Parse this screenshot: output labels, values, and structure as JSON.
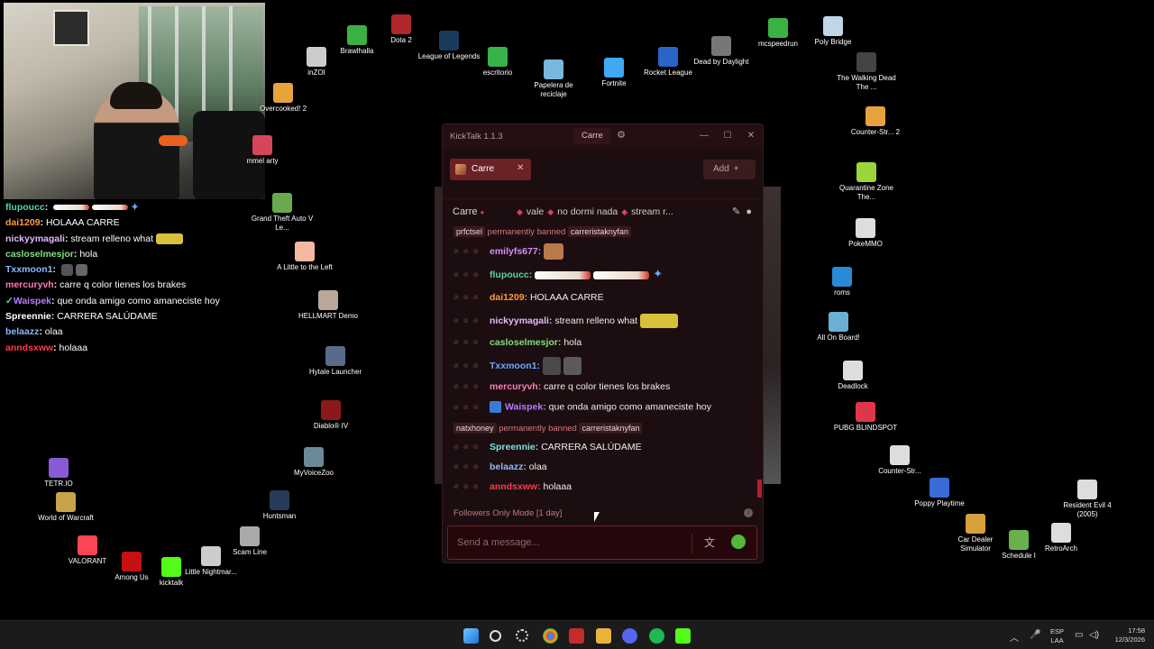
{
  "desktop_icons": [
    {
      "label": "Brawlhalla",
      "color": "#3bb143"
    },
    {
      "label": "Dota 2",
      "color": "#b0262c"
    },
    {
      "label": "League of Legends",
      "color": "#1a3a5c"
    },
    {
      "label": "escritorio",
      "color": "#37b34a"
    },
    {
      "label": "Papelera de reciclaje",
      "color": "#7ab7de"
    },
    {
      "label": "Fortnite",
      "color": "#3fa9f5"
    },
    {
      "label": "Rocket League",
      "color": "#2a64c9"
    },
    {
      "label": "Dead by Daylight",
      "color": "#777777"
    },
    {
      "label": "mcspeedrun",
      "color": "#3bb143"
    },
    {
      "label": "Poly Bridge",
      "color": "#c0d6e4"
    },
    {
      "label": "The Walking Dead The ...",
      "color": "#444444"
    },
    {
      "label": "inZOI",
      "color": "#cccccc"
    },
    {
      "label": "Overcooked! 2",
      "color": "#e8a33c"
    },
    {
      "label": "mmel arty",
      "color": "#d6455b"
    },
    {
      "label": "Grand Theft Auto V Le...",
      "color": "#6aa84f"
    },
    {
      "label": "A Little to the Left",
      "color": "#f2b8a0"
    },
    {
      "label": "HELLMART Demo",
      "color": "#b8a89a"
    },
    {
      "label": "Hytale Launcher",
      "color": "#5a6a8a"
    },
    {
      "label": "Diablo® IV",
      "color": "#8a1a1a"
    },
    {
      "label": "MyVoiceZoo",
      "color": "#6a8a9a"
    },
    {
      "label": "Huntsman",
      "color": "#2a3a5a"
    },
    {
      "label": "Scam Line",
      "color": "#aaaaaa"
    },
    {
      "label": "Little Nightmar...",
      "color": "#cccccc"
    },
    {
      "label": "kicktalk",
      "color": "#53fc18"
    },
    {
      "label": "Among Us",
      "color": "#c51111"
    },
    {
      "label": "VALORANT",
      "color": "#fd4556"
    },
    {
      "label": "World of Warcraft",
      "color": "#c7a34a"
    },
    {
      "label": "TETR.IO",
      "color": "#8a5ad6"
    },
    {
      "label": "Counter-Str... 2",
      "color": "#e6a23c"
    },
    {
      "label": "Quarantine Zone The...",
      "color": "#9ad63a"
    },
    {
      "label": "PokeMMO",
      "color": "#dddddd"
    },
    {
      "label": "roms",
      "color": "#2a8ad6"
    },
    {
      "label": "All On Board!",
      "color": "#6ab0d6"
    },
    {
      "label": "Deadlock",
      "color": "#dddddd"
    },
    {
      "label": "PUBG BLINDSPOT",
      "color": "#e0364b"
    },
    {
      "label": "Counter-Str...",
      "color": "#dddddd"
    },
    {
      "label": "Poppy Playtime",
      "color": "#3a6ad6"
    },
    {
      "label": "Car Dealer Simulator",
      "color": "#d6a03a"
    },
    {
      "label": "Schedule I",
      "color": "#6ab04c"
    },
    {
      "label": "RetroArch",
      "color": "#dddddd"
    },
    {
      "label": "Resident Evil 4 (2005)",
      "color": "#dddddd"
    }
  ],
  "overlay_chat": [
    {
      "user": "flupoucc",
      "color": "#53d6a0",
      "text": ""
    },
    {
      "user": "dai1209",
      "color": "#ff9a3c",
      "text": "HOLAAA CARRE"
    },
    {
      "user": "nickyymagali",
      "color": "#e4b8ff",
      "text": "stream relleno what"
    },
    {
      "user": "casloselmesjor",
      "color": "#7ee07e",
      "text": "hola"
    },
    {
      "user": "Txxmoon1",
      "color": "#8ab8ff",
      "text": ""
    },
    {
      "user": "mercuryvh",
      "color": "#ff7ab8",
      "text": "carre q color tienes los brakes"
    },
    {
      "user": "Waispek",
      "color": "#b57bff",
      "text": "que onda amigo como amaneciste hoy"
    },
    {
      "user": "Spreennie",
      "color": "#ffffff",
      "text": "CARRERA SALÚDAME"
    },
    {
      "user": "belaazz",
      "color": "#8ab8ff",
      "text": "olaa"
    },
    {
      "user": "anndsxww",
      "color": "#ff3a4a",
      "text": "holaaa"
    }
  ],
  "kicktalk": {
    "app_title": "KickTalk 1.1.3",
    "title_tab": "Carre",
    "channel_tab": "Carre",
    "add_label": "Add",
    "channel_name": "Carre",
    "stream_title": [
      "vale",
      "no dormi nada",
      "stream r..."
    ],
    "ban_1": {
      "user": "prfctsel",
      "text": "permanently banned",
      "by": "carreristaknyfan"
    },
    "messages": [
      {
        "user": "emilyfs677:",
        "color": "#d58cff",
        "text": ""
      },
      {
        "user": "flupoucc:",
        "color": "#53d6a0",
        "text": ""
      },
      {
        "user": "dai1209:",
        "color": "#ff9a3c",
        "text": "HOLAAA CARRE"
      },
      {
        "user": "nickyymagali:",
        "color": "#e4b8ff",
        "text": "stream relleno what"
      },
      {
        "user": "casloselmesjor:",
        "color": "#7ee07e",
        "text": "hola"
      },
      {
        "user": "Txxmoon1:",
        "color": "#6aa8ff",
        "text": ""
      },
      {
        "user": "mercuryvh:",
        "color": "#ff7ab8",
        "text": "carre q color tienes los brakes"
      },
      {
        "user": "Waispek:",
        "color": "#b57bff",
        "text": "que onda amigo como amaneciste hoy"
      },
      {
        "user": "Spreennie:",
        "color": "#7ee0e0",
        "text": "CARRERA SALÚDAME"
      },
      {
        "user": "belaazz:",
        "color": "#8ab8ff",
        "text": "olaa"
      },
      {
        "user": "anndsxww:",
        "color": "#ff3a4a",
        "text": "holaaa"
      }
    ],
    "ban_2": {
      "user": "natxhoney",
      "text": "permanently banned",
      "by": "carreristaknyfan"
    },
    "followers_mode": "Followers Only Mode [1 day]",
    "input_placeholder": "Send a message..."
  },
  "taskbar": {
    "lang_top": "ESP",
    "lang_bottom": "LAA",
    "time": "17:58",
    "date": "12/3/2026"
  }
}
